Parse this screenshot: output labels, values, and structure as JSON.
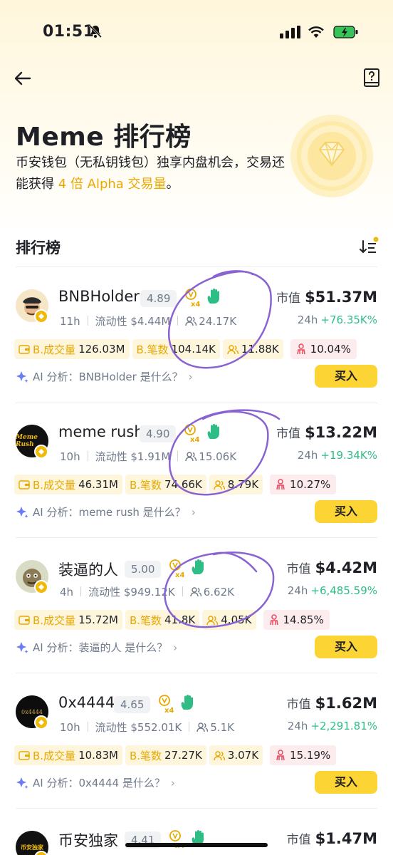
{
  "status": {
    "time": "01:51"
  },
  "hero": {
    "title": "Meme 排行榜",
    "desc_part1": "币安钱包（无私钥钱包）独享内盘机会，交易还能获得 ",
    "desc_highlight": "4 倍 Alpha 交易量",
    "desc_part2": "。"
  },
  "ranking": {
    "title": "排行榜"
  },
  "labels": {
    "liquidity": "流动性",
    "mcap": "市值",
    "h24": "24h",
    "b_volume": "B.成交量",
    "b_count": "B.笔数",
    "ai_prefix": "AI 分析：",
    "buy": "买入"
  },
  "tokens": [
    {
      "name": "BNBHolder",
      "score": "4.89",
      "age": "11h",
      "liquidity": "$4.44M",
      "holders": "24.17K",
      "mcap": "$51.37M",
      "change": "+76.35K%",
      "volume": "126.03M",
      "count": "104.14K",
      "traders": "11.88K",
      "ratio": "10.04%",
      "ai": "BNBHolder 是什么？"
    },
    {
      "name": "meme rush",
      "score": "4.90",
      "age": "10h",
      "liquidity": "$1.91M",
      "holders": "15.06K",
      "mcap": "$13.22M",
      "change": "+19.34K%",
      "volume": "46.31M",
      "count": "74.66K",
      "traders": "8.79K",
      "ratio": "10.27%",
      "ai": "meme rush 是什么？",
      "avatar_text": "Meme Rush"
    },
    {
      "name": "装逼的人",
      "score": "5.00",
      "age": "4h",
      "liquidity": "$949.12K",
      "holders": "6.62K",
      "mcap": "$4.42M",
      "change": "+6,485.59%",
      "volume": "15.72M",
      "count": "41.8K",
      "traders": "4.05K",
      "ratio": "14.85%",
      "ai": "装逼的人 是什么？"
    },
    {
      "name": "0x4444",
      "score": "4.65",
      "age": "10h",
      "liquidity": "$552.01K",
      "holders": "5.1K",
      "mcap": "$1.62M",
      "change": "+2,291.81%",
      "volume": "10.83M",
      "count": "27.27K",
      "traders": "3.07K",
      "ratio": "15.19%",
      "ai": "0x4444 是什么？",
      "avatar_text": "0x4444"
    },
    {
      "name": "币安独家",
      "score": "4.41",
      "mcap": "$1.47M",
      "avatar_text": "币安独家"
    }
  ],
  "colors": {
    "accent": "#f0b90b",
    "buy_button": "#fcd535",
    "positive": "#2ebd85",
    "annotation": "#8a63d2"
  }
}
